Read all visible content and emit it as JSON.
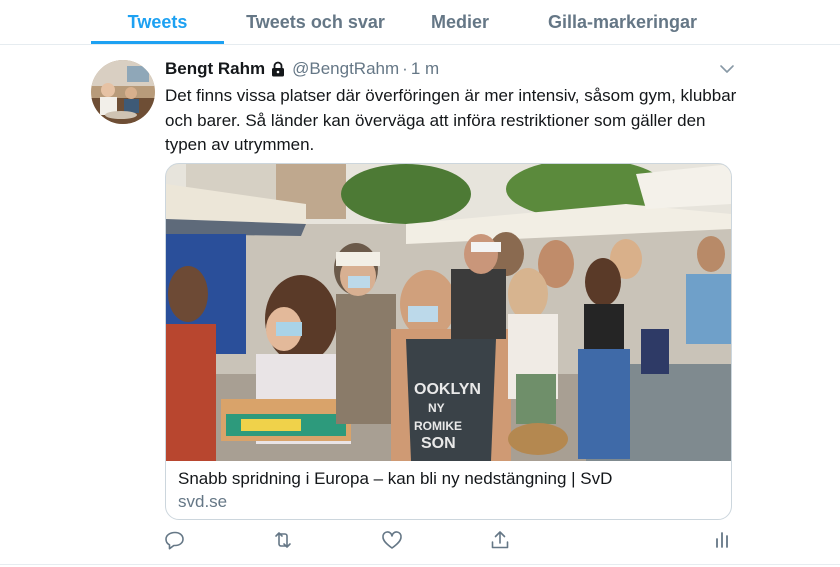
{
  "tabs": [
    {
      "label": "Tweets",
      "active": true
    },
    {
      "label": "Tweets och svar",
      "active": false
    },
    {
      "label": "Medier",
      "active": false
    },
    {
      "label": "Gilla-markeringar",
      "active": false
    }
  ],
  "tweet": {
    "author_name": "Bengt Rahm",
    "handle": "@BengtRahm",
    "separator": "·",
    "time": "1 m",
    "text": "Det finns vissa platser där överföringen är mer intensiv, såsom gym, klubbar och barer. Så länder kan överväga att införa restriktioner som gäller den typen av utrymmen.",
    "protected_icon": "lock-icon",
    "card": {
      "title": "Snabb spridning i Europa – kan bli ny nedstängning | SvD",
      "domain": "svd.se",
      "image_alt": "Outdoor market crowd wearing face masks",
      "shirt_text": "OOKLYN NY ROMIKE SON"
    }
  },
  "actions": [
    {
      "icon": "reply-icon"
    },
    {
      "icon": "retweet-icon"
    },
    {
      "icon": "like-icon"
    },
    {
      "icon": "share-icon"
    },
    {
      "icon": "analytics-icon"
    }
  ],
  "colors": {
    "accent": "#1da1f2",
    "text": "#14171a",
    "secondary": "#657786",
    "border": "#ccd6dd"
  }
}
